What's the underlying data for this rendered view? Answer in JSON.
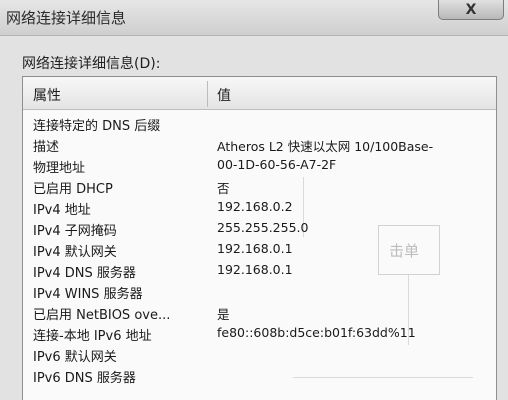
{
  "window": {
    "title": "网络连接详细信息",
    "close_glyph": "X"
  },
  "section_label": "网络连接详细信息(D):",
  "table": {
    "columns": [
      "属性",
      "值"
    ],
    "rows": [
      {
        "property": "连接特定的 DNS 后缀",
        "value": ""
      },
      {
        "property": "描述",
        "value": "Atheros L2 快速以太网 10/100Base-"
      },
      {
        "property": "物理地址",
        "value": "00-1D-60-56-A7-2F"
      },
      {
        "property": "已启用 DHCP",
        "value": "否"
      },
      {
        "property": "IPv4 地址",
        "value": "192.168.0.2"
      },
      {
        "property": "IPv4 子网掩码",
        "value": "255.255.255.0"
      },
      {
        "property": "IPv4 默认网关",
        "value": "192.168.0.1"
      },
      {
        "property": "IPv4 DNS 服务器",
        "value": "192.168.0.1"
      },
      {
        "property": "IPv4 WINS 服务器",
        "value": ""
      },
      {
        "property": "已启用 NetBIOS ove...",
        "value": "是"
      },
      {
        "property": "连接-本地 IPv6 地址",
        "value": "fe80::608b:d5ce:b01f:63dd%11"
      },
      {
        "property": "IPv6 默认网关",
        "value": ""
      },
      {
        "property": "IPv6 DNS 服务器",
        "value": ""
      }
    ]
  },
  "bleed_text": "击单"
}
